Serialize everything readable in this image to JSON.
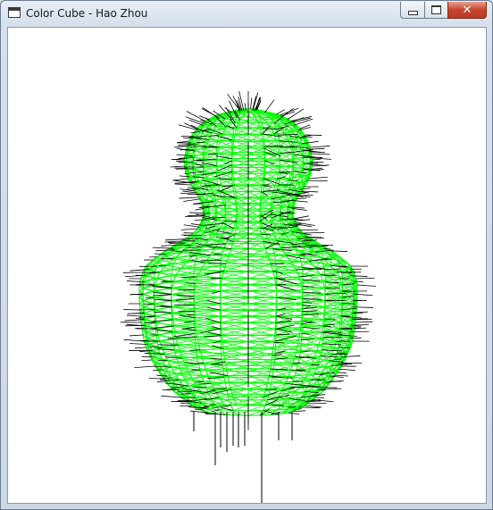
{
  "window": {
    "title": "Color Cube - Hao Zhou",
    "icon": "app-window-icon"
  },
  "controls": {
    "minimize_icon": "minimize-icon",
    "maximize_icon": "maximize-icon",
    "close_icon": "close-icon",
    "close_glyph": "✕"
  },
  "viewport": {
    "background": "#ffffff",
    "mesh_color": "#00ff00",
    "normal_color": "#000000",
    "model": "wireframe-vase-with-normals"
  }
}
